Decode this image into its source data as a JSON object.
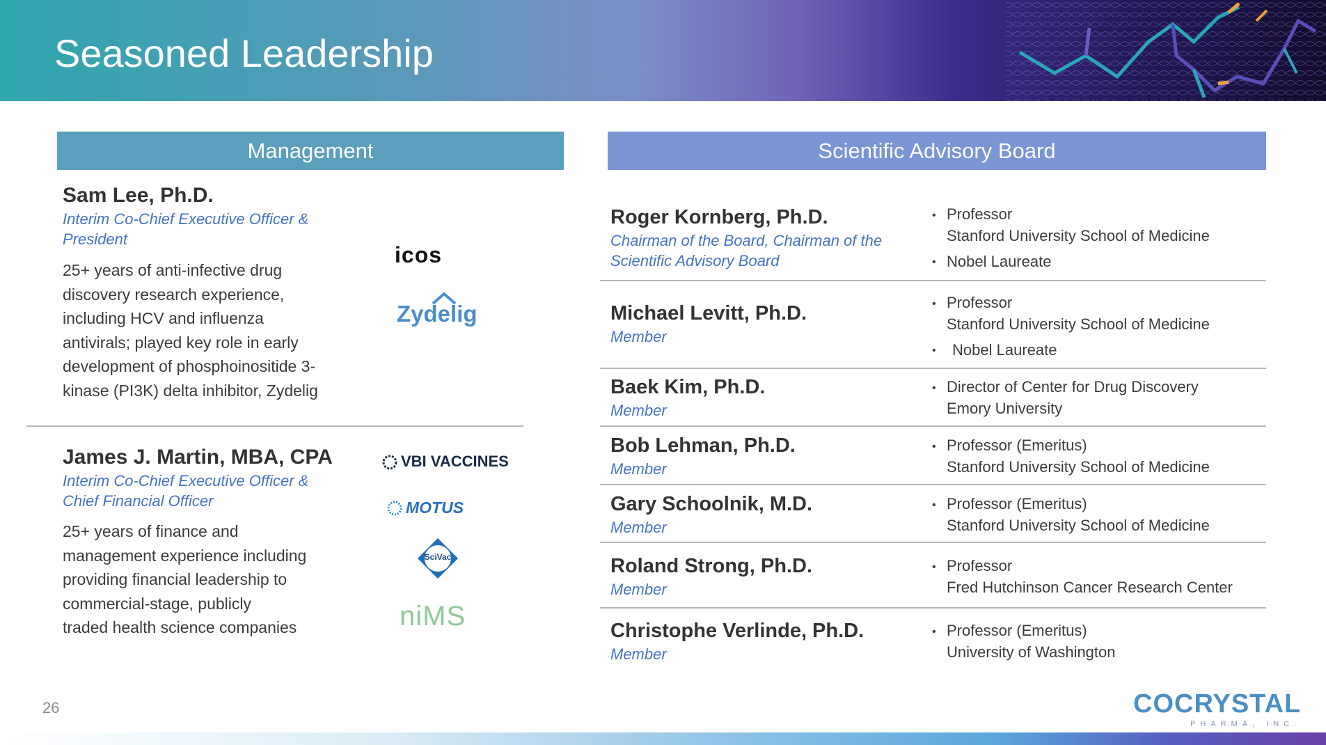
{
  "slide": {
    "title": "Seasoned Leadership",
    "page_number": "26"
  },
  "management": {
    "header": "Management",
    "people": [
      {
        "name": "Sam Lee, Ph.D.",
        "role_line1": "Interim Co-Chief Executive Officer &",
        "role_line2": "President",
        "bio": [
          "25+ years of anti-infective drug",
          "discovery research experience,",
          "including HCV and influenza",
          "antivirals; played key role in early",
          "development of phosphoinositide 3-",
          "kinase (PI3K) delta inhibitor, Zydelig"
        ],
        "logos": [
          "icos",
          "Zydelig"
        ]
      },
      {
        "name": "James J. Martin, MBA, CPA",
        "role_line1": "Interim Co-Chief Executive Officer &",
        "role_line2": "Chief Financial Officer",
        "bio": [
          "25+ years of finance and",
          "management experience including",
          "providing financial leadership to",
          "commercial-stage, publicly",
          "traded health science companies"
        ],
        "logos": [
          "VBI VACCINES",
          "MOTUS",
          "SciVac",
          "niMS"
        ]
      }
    ]
  },
  "sab": {
    "header": "Scientific Advisory Board",
    "members": [
      {
        "name": "Roger Kornberg, Ph.D.",
        "role_line1": "Chairman of the Board, Chairman of the",
        "role_line2": "Scientific Advisory Board",
        "d1": "Professor",
        "d2": "Stanford University School of Medicine",
        "d3": "Nobel Laureate"
      },
      {
        "name": "Michael Levitt, Ph.D.",
        "role_line1": "Member",
        "d1": "Professor",
        "d2": "Stanford University School of Medicine",
        "d3": "Nobel Laureate"
      },
      {
        "name": "Baek Kim, Ph.D.",
        "role_line1": "Member",
        "d1": "Director of Center for Drug Discovery",
        "d2": "Emory University"
      },
      {
        "name": "Bob Lehman, Ph.D.",
        "role_line1": "Member",
        "d1": "Professor (Emeritus)",
        "d2": "Stanford University School of Medicine"
      },
      {
        "name": "Gary Schoolnik, M.D.",
        "role_line1": "Member",
        "d1": "Professor (Emeritus)",
        "d2": "Stanford University School of Medicine"
      },
      {
        "name": "Roland Strong, Ph.D.",
        "role_line1": "Member",
        "d1": "Professor",
        "d2": "Fred Hutchinson Cancer Research Center"
      },
      {
        "name": "Christophe Verlinde, Ph.D.",
        "role_line1": "Member",
        "d1": "Professor (Emeritus)",
        "d2": "University of Washington"
      }
    ]
  },
  "brand": {
    "name": "COCRYSTAL",
    "tagline": "PHARMA, INC."
  },
  "colors": {
    "accent_blue": "#4472c4",
    "management_header": "#5a9fbb",
    "sab_header": "#7a95d4"
  }
}
